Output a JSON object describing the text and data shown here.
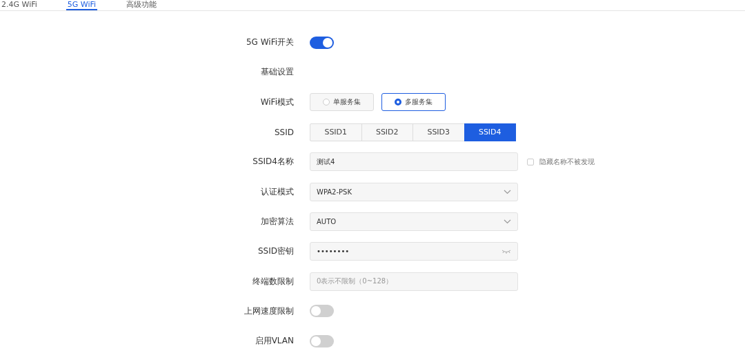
{
  "tabs": [
    {
      "label": "2.4G WiFi",
      "selected": false
    },
    {
      "label": "5G WiFi",
      "selected": true
    },
    {
      "label": "高级功能",
      "selected": false
    }
  ],
  "rows": [
    {
      "kind": "toggle",
      "label": "5G WiFi开关",
      "on": true
    },
    {
      "kind": "heading",
      "label": "基础设置"
    },
    {
      "kind": "radio",
      "label": "WiFi模式",
      "options": [
        {
          "label": "单服务集",
          "selected": false
        },
        {
          "label": "多服务集",
          "selected": true
        }
      ]
    },
    {
      "kind": "segmented",
      "label": "SSID",
      "options": [
        {
          "label": "SSID1",
          "selected": false
        },
        {
          "label": "SSID2",
          "selected": false
        },
        {
          "label": "SSID3",
          "selected": false
        },
        {
          "label": "SSID4",
          "selected": true
        }
      ]
    },
    {
      "kind": "text",
      "label": "SSID4名称",
      "value": "测试4",
      "checkbox": {
        "label": "隐藏名称不被发现",
        "checked": false
      }
    },
    {
      "kind": "select",
      "label": "认证模式",
      "value": "WPA2-PSK"
    },
    {
      "kind": "select",
      "label": "加密算法",
      "value": "AUTO"
    },
    {
      "kind": "password",
      "label": "SSID密钥",
      "value": "••••••••"
    },
    {
      "kind": "text",
      "label": "终端数限制",
      "placeholder": "0表示不限制（0~128）"
    },
    {
      "kind": "toggle",
      "label": "上网速度限制",
      "on": false
    },
    {
      "kind": "toggle",
      "label": "启用VLAN",
      "on": false
    }
  ]
}
